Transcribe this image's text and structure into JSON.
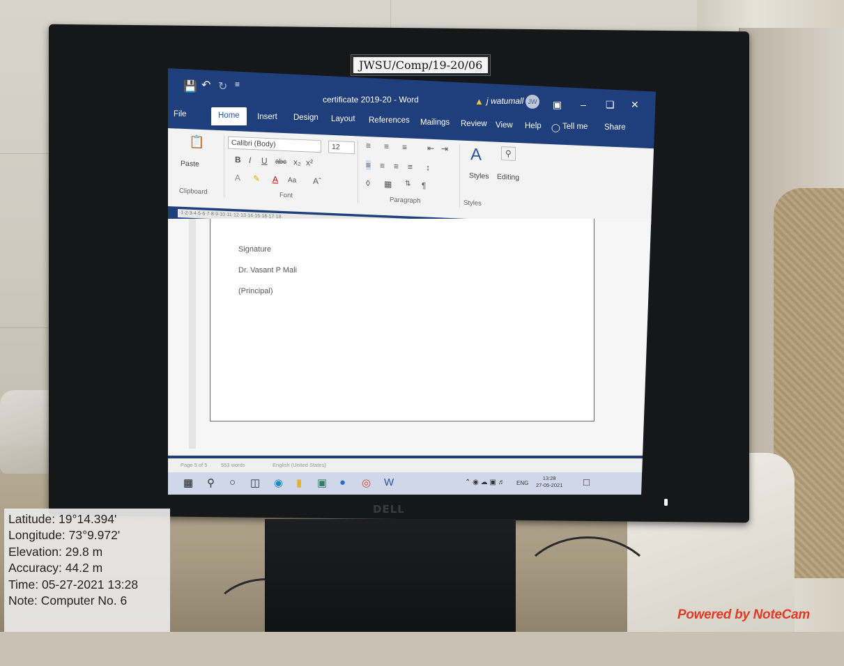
{
  "sticker": "JWSU/Comp/19-20/06",
  "word": {
    "doc_title": "certificate 2019-20 - Word",
    "user_name": "j watumall",
    "user_initials": "JW",
    "tabs": [
      "File",
      "Home",
      "Insert",
      "Design",
      "Layout",
      "References",
      "Mailings",
      "Review",
      "View",
      "Help"
    ],
    "tell_me": "Tell me",
    "share": "Share",
    "ribbon": {
      "paste": "Paste",
      "clipboard": "Clipboard",
      "font_name": "Calibri (Body)",
      "font_size": "12",
      "font_group": "Font",
      "paragraph_group": "Paragraph",
      "styles": "Styles",
      "styles_group": "Styles",
      "editing": "Editing"
    },
    "document_lines": [
      "Signature",
      "Dr. Vasant P Mali",
      "(Principal)"
    ],
    "statusbar": {
      "page": "Page 5 of 5",
      "words": "553 words",
      "language": "English (United States)"
    },
    "taskbar": {
      "lang": "ENG",
      "time": "13:28",
      "date": "27-05-2021"
    }
  },
  "monitor_brand": "DELL",
  "gps": {
    "latitude": "Latitude: 19°14.394'",
    "longitude": "Longitude: 73°9.972'",
    "elevation": "Elevation: 29.8 m",
    "accuracy": "Accuracy: 44.2 m",
    "time": "Time: 05-27-2021 13:28",
    "note": "Note: Computer No. 6"
  },
  "watermark": "Powered by NoteCam",
  "colors": {
    "word_blue": "#1f3f7c",
    "watermark_red": "#e23b27"
  }
}
